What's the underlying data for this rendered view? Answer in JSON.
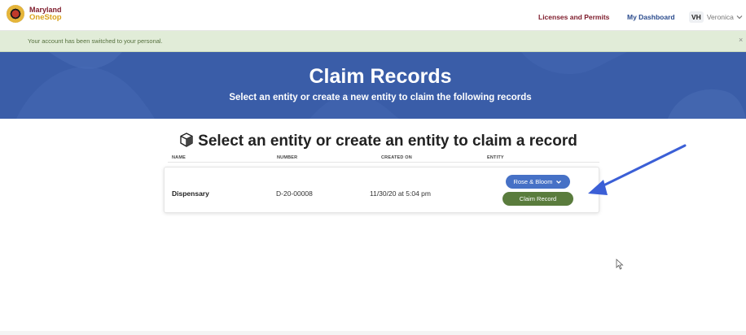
{
  "brand": {
    "line1": "Maryland",
    "line2": "OneStop"
  },
  "nav": {
    "licenses": "Licenses and Permits",
    "dashboard": "My Dashboard",
    "user_initials": "VH",
    "user_name": "Veronica"
  },
  "alert": {
    "message": "Your account has been switched to your personal.",
    "close": "×"
  },
  "banner": {
    "title": "Claim Records",
    "subtitle": "Select an entity or create a new entity to claim the following records"
  },
  "section": {
    "title": "Select an entity or create an entity to claim a record"
  },
  "table": {
    "headers": {
      "name": "NAME",
      "number": "NUMBER",
      "created": "CREATED ON",
      "entity": "ENTITY"
    },
    "rows": [
      {
        "name": "Dispensary",
        "number": "D-20-00008",
        "created": "11/30/20 at 5:04 pm",
        "entity_selected": "Rose & Bloom",
        "action": "Claim Record"
      }
    ]
  },
  "colors": {
    "brand_maroon": "#7d1a2a",
    "banner_blue": "#3a5da8",
    "entity_button": "#4671c6",
    "claim_button": "#5a7c3d",
    "annotation_arrow": "#3b5fd6"
  }
}
